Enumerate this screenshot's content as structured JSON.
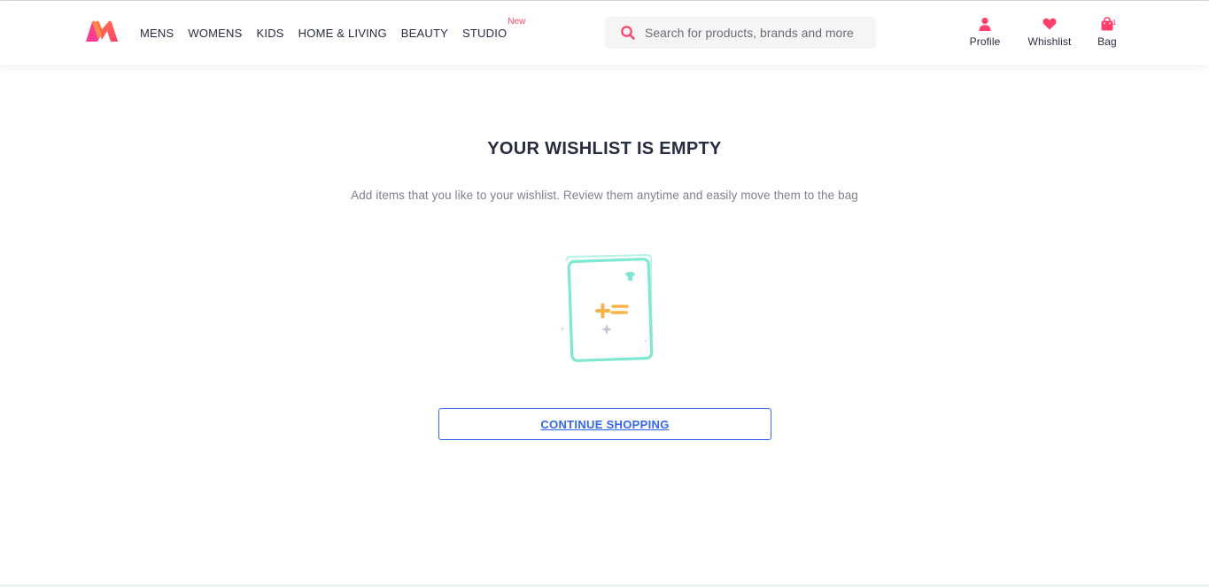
{
  "header": {
    "nav": [
      {
        "label": "MENS"
      },
      {
        "label": "WOMENS"
      },
      {
        "label": "KIDS"
      },
      {
        "label": "HOME & LIVING"
      },
      {
        "label": "BEAUTY"
      },
      {
        "label": "STUDIO",
        "badge": "New"
      }
    ],
    "search": {
      "placeholder": "Search for products, brands and more",
      "icon": "search-icon"
    },
    "actions": {
      "profile": {
        "label": "Profile",
        "icon": "person-icon"
      },
      "wishlist": {
        "label": "Whishlist",
        "icon": "heart-icon"
      },
      "bag": {
        "label": "Bag",
        "icon": "bag-icon",
        "count": "1"
      }
    }
  },
  "main": {
    "title": "YOUR WISHLIST IS EMPTY",
    "subtitle": "Add items that you like to your wishlist. Review them anytime and easily move them to the bag",
    "illustration": "empty-wishlist-illustration",
    "continue_label": "CONTINUE SHOPPING"
  },
  "colors": {
    "brand_pink": "#ff3f6c",
    "link_blue": "#3466e8",
    "text_dark": "#282c3f",
    "text_muted": "#7e818c",
    "illustration_teal": "#7ee8d2",
    "illustration_orange": "#f7b24a"
  }
}
